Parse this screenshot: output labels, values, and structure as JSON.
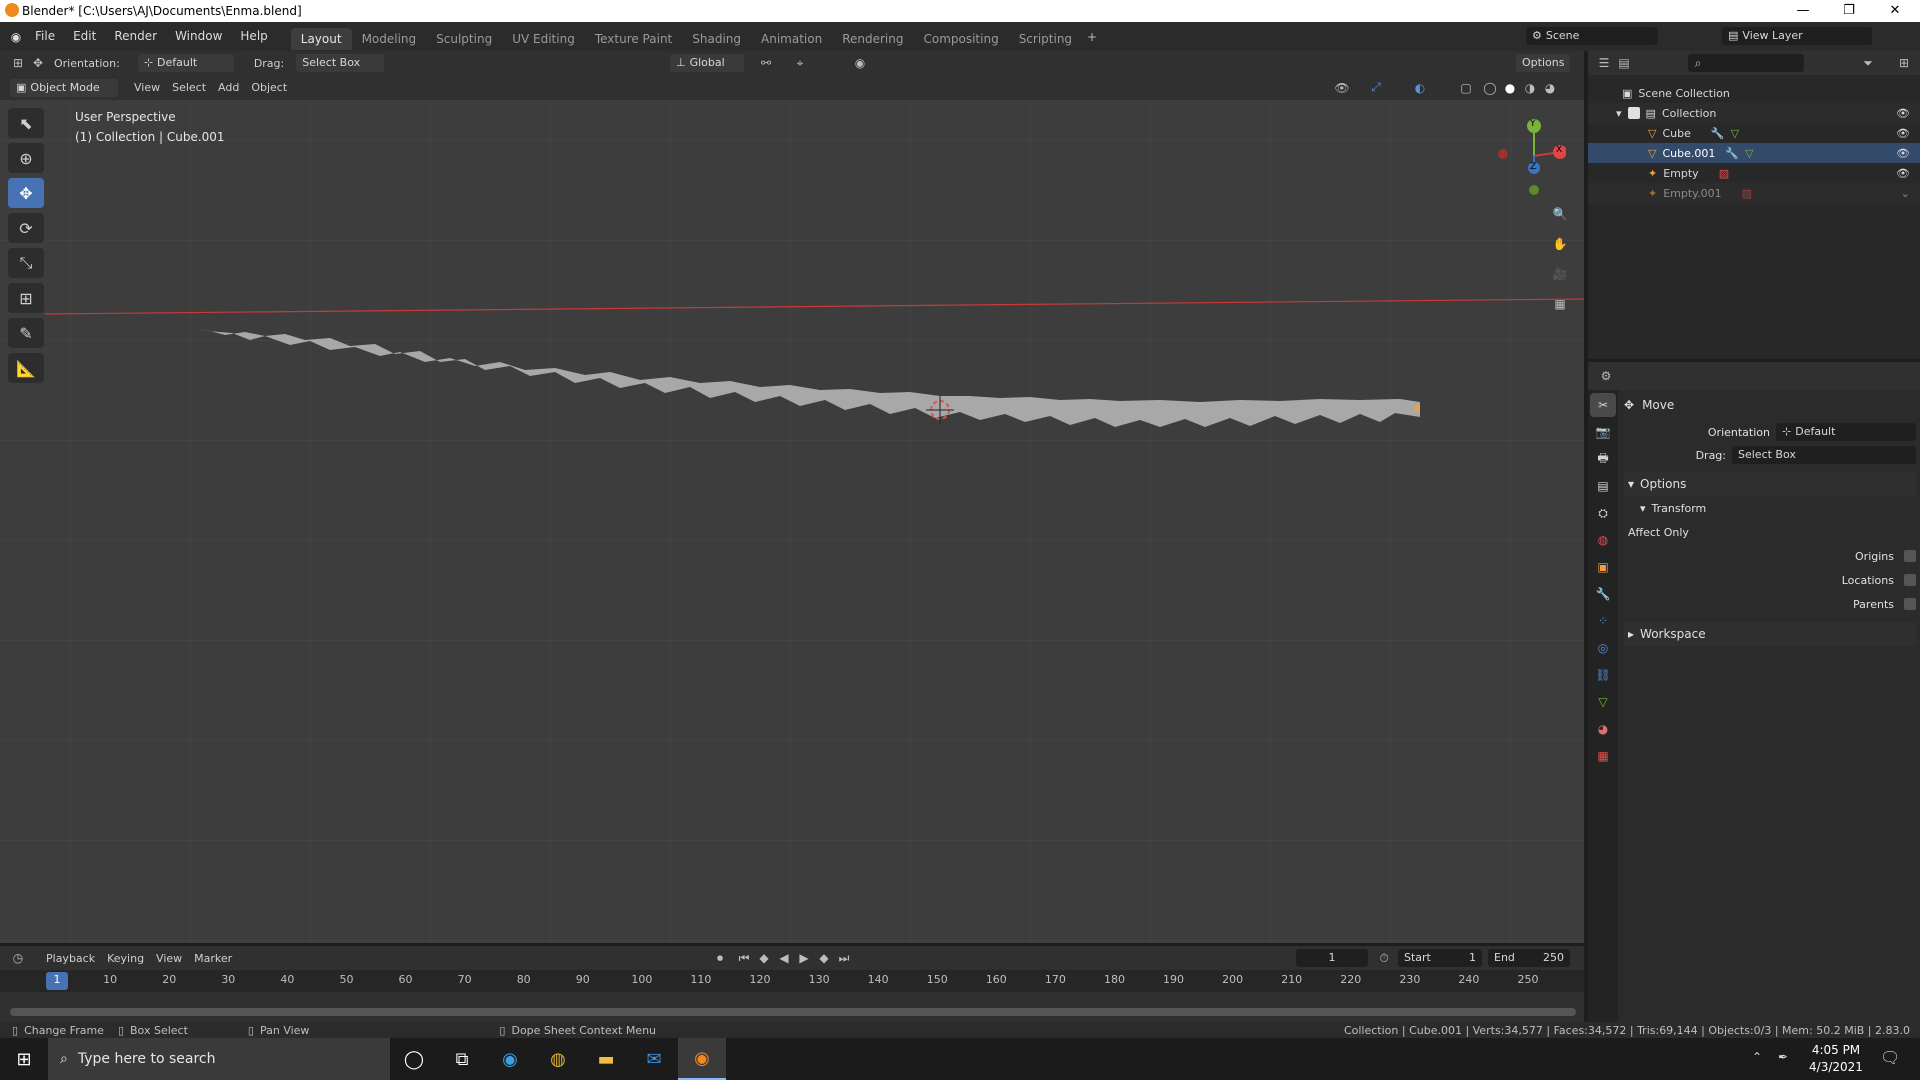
{
  "window": {
    "title": "Blender* [C:\\Users\\AJ\\Documents\\Enma.blend]",
    "minimize": "—",
    "restore": "❐",
    "close": "✕"
  },
  "menu": [
    "File",
    "Edit",
    "Render",
    "Window",
    "Help"
  ],
  "workspaces": [
    "Layout",
    "Modeling",
    "Sculpting",
    "UV Editing",
    "Texture Paint",
    "Shading",
    "Animation",
    "Rendering",
    "Compositing",
    "Scripting"
  ],
  "active_workspace": "Layout",
  "scene": {
    "label": "Scene",
    "view_layer": "View Layer"
  },
  "tool_header": {
    "orientation_label": "Orientation:",
    "orientation_value": "Default",
    "drag_label": "Drag:",
    "drag_value": "Select Box",
    "transform_space": "Global",
    "options": "Options"
  },
  "viewport_header": {
    "mode": "Object Mode",
    "menus": [
      "View",
      "Select",
      "Add",
      "Object"
    ]
  },
  "viewport": {
    "perspective": "User Perspective",
    "collection_info": "(1) Collection | Cube.001",
    "axis_x": "X",
    "axis_y": "Y",
    "axis_z": "Z"
  },
  "outliner": {
    "root": "Scene Collection",
    "collection": "Collection",
    "items": [
      {
        "name": "Cube"
      },
      {
        "name": "Cube.001"
      },
      {
        "name": "Empty"
      },
      {
        "name": "Empty.001"
      }
    ]
  },
  "properties": {
    "tool_name": "Move",
    "orientation_label": "Orientation",
    "orientation_value": "Default",
    "drag_label": "Drag:",
    "drag_value": "Select Box",
    "options_section": "Options",
    "transform_section": "Transform",
    "affect_only": "Affect Only",
    "origins": "Origins",
    "locations": "Locations",
    "parents": "Parents",
    "workspace_section": "Workspace"
  },
  "timeline": {
    "menus": [
      "Playback",
      "Keying",
      "View",
      "Marker"
    ],
    "current_frame": "1",
    "start_label": "Start",
    "start_value": "1",
    "end_label": "End",
    "end_value": "250",
    "ticks": [
      "1",
      "10",
      "20",
      "30",
      "40",
      "50",
      "60",
      "70",
      "80",
      "90",
      "100",
      "110",
      "120",
      "130",
      "140",
      "150",
      "160",
      "170",
      "180",
      "190",
      "200",
      "210",
      "220",
      "230",
      "240",
      "250"
    ]
  },
  "statusbar": {
    "change_frame": "Change Frame",
    "box_select": "Box Select",
    "pan_view": "Pan View",
    "context_menu": "Dope Sheet Context Menu",
    "stats": "Collection | Cube.001 | Verts:34,577 | Faces:34,572 | Tris:69,144 | Objects:0/3 | Mem: 50.2 MiB | 2.83.0"
  },
  "taskbar": {
    "search_placeholder": "Type here to search",
    "time": "4:05 PM",
    "date": "4/3/2021"
  },
  "colors": {
    "accent": "#4772b3",
    "x_axis": "#c83a3a",
    "y_axis": "#7ab33a",
    "z_axis": "#3a72c8",
    "object": "#a8a8a8"
  }
}
